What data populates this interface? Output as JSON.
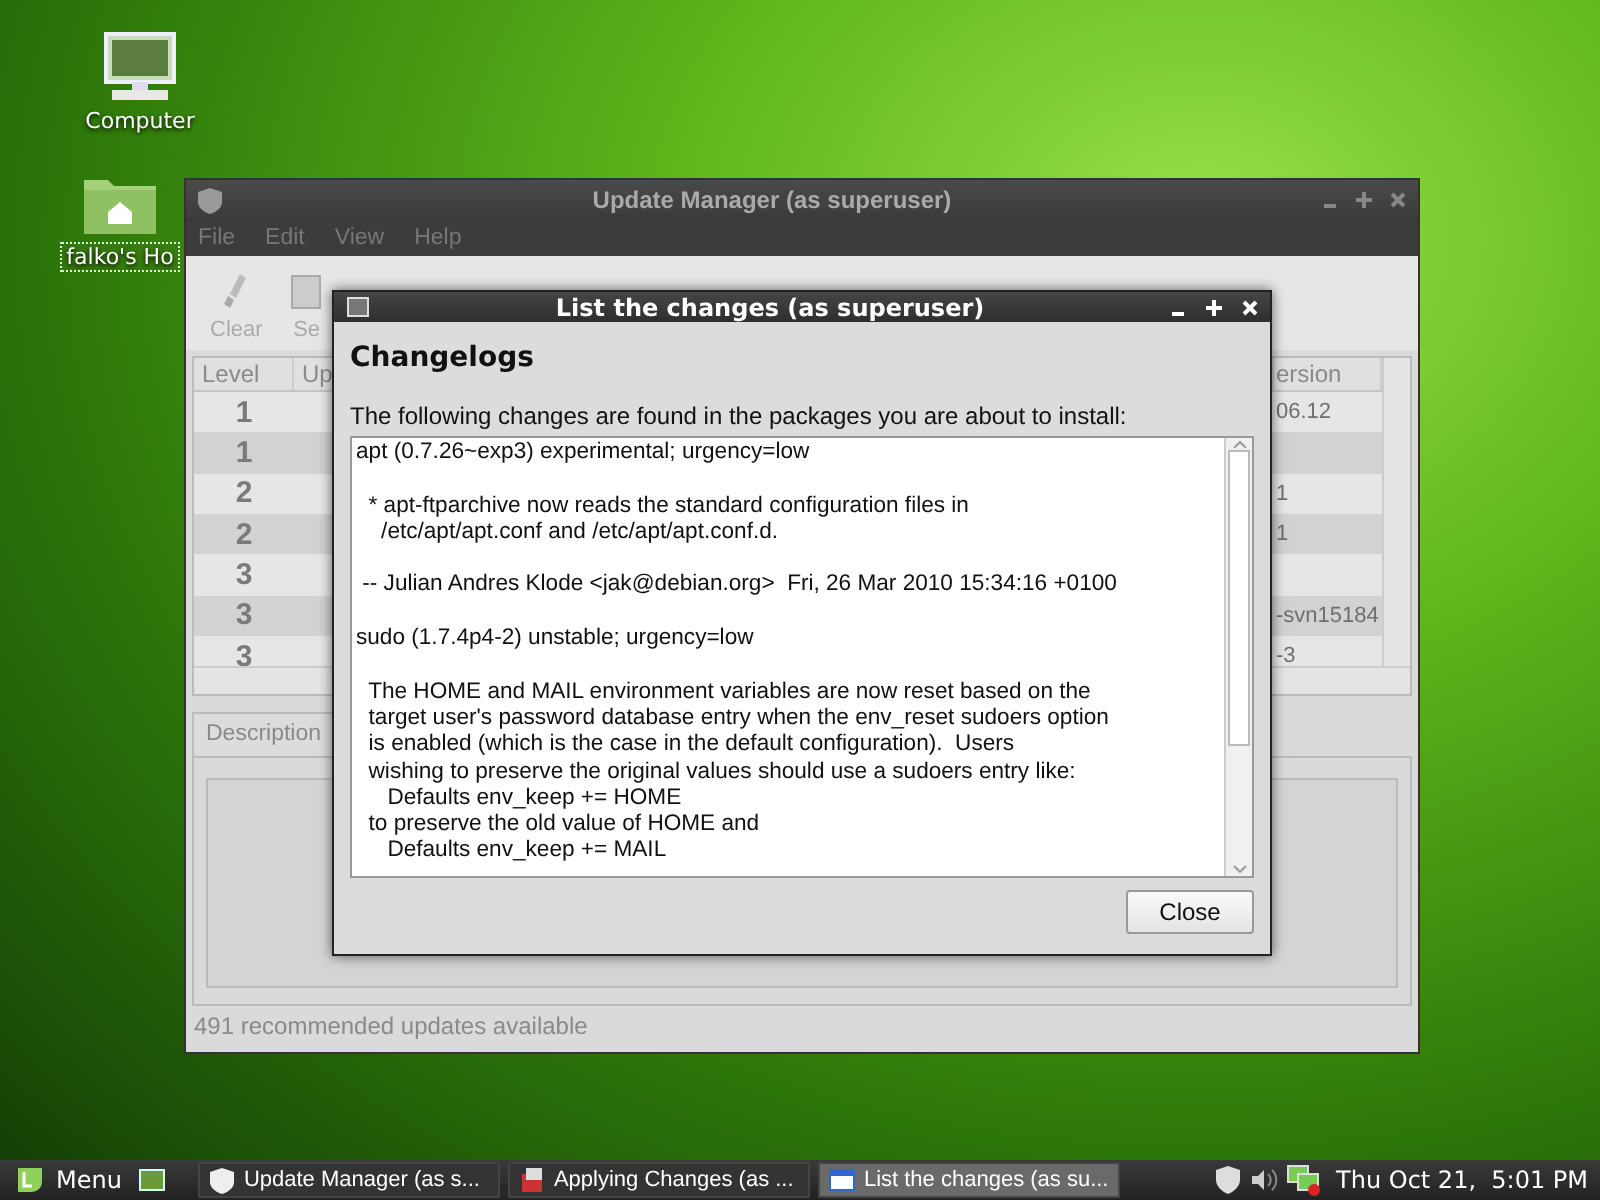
{
  "desktop_icons": [
    {
      "label": "Computer",
      "kind": "computer",
      "selected": false
    },
    {
      "label": "falko's Ho",
      "kind": "home",
      "selected": true
    }
  ],
  "update_window": {
    "title": "Update Manager (as superuser)",
    "menu": [
      "File",
      "Edit",
      "View",
      "Help"
    ],
    "toolbar": [
      "Clear",
      "Se"
    ],
    "columns": [
      "Level",
      "Up",
      "ersion"
    ],
    "rows": [
      {
        "level": "1",
        "version": "06.12"
      },
      {
        "level": "1"
      },
      {
        "level": "2",
        "version": "1"
      },
      {
        "level": "2",
        "version": "1"
      },
      {
        "level": "3"
      },
      {
        "level": "3",
        "version": "-svn15184"
      },
      {
        "level": "3",
        "version": "-3"
      }
    ],
    "tabs": [
      {
        "label": "Description",
        "selected": true
      }
    ],
    "status_bar": "491 recommended updates available"
  },
  "dialog": {
    "title": "List the changes (as superuser)",
    "heading": "Changelogs",
    "intro": "The following changes are found in the packages you are about to install:",
    "changelog": [
      {
        "lines": [
          "apt (0.7.26~exp3) experimental; urgency=low"
        ]
      },
      {
        "lines": [
          "  * apt-ftparchive now reads the standard configuration files in",
          "    /etc/apt/apt.conf and /etc/apt/apt.conf.d."
        ]
      },
      {
        "lines": [
          " -- Julian Andres Klode <jak@debian.org>  Fri, 26 Mar 2010 15:34:16 +0100"
        ]
      },
      {
        "lines": [
          "sudo (1.7.4p4-2) unstable; urgency=low"
        ]
      },
      {
        "lines": [
          "  The HOME and MAIL environment variables are now reset based on the",
          "  target user's password database entry when the env_reset sudoers option",
          "  is enabled (which is the case in the default configuration).  Users",
          "  wishing to preserve the original values should use a sudoers entry like:",
          "     Defaults env_keep += HOME",
          "  to preserve the old value of HOME and",
          "     Defaults env_keep += MAIL"
        ]
      }
    ],
    "buttons": [
      "Close"
    ]
  },
  "taskbar": {
    "menu": "Menu",
    "tasks": [
      {
        "label": "Update Manager (as s...",
        "kind": "shield",
        "selected": false
      },
      {
        "label": "Applying Changes (as ...",
        "kind": "installer",
        "selected": false
      },
      {
        "label": "List the changes (as su...",
        "kind": "window",
        "selected": true
      }
    ],
    "clock": "Thu Oct 21,  5:01 PM"
  }
}
